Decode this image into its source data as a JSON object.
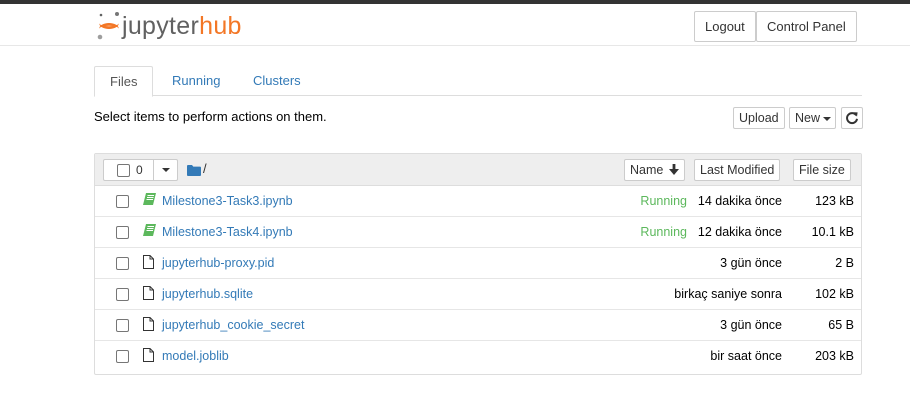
{
  "header": {
    "logo_jupyter": "jupyter",
    "logo_hub": "hub",
    "logout_label": "Logout",
    "control_panel_label": "Control Panel"
  },
  "tabs": [
    {
      "label": "Files",
      "active": true
    },
    {
      "label": "Running",
      "active": false
    },
    {
      "label": "Clusters",
      "active": false
    }
  ],
  "toolbar": {
    "instructions": "Select items to perform actions on them.",
    "upload_label": "Upload",
    "new_label": "New"
  },
  "list_header": {
    "selected_count": "0",
    "breadcrumb": "/",
    "sort_name_label": "Name",
    "sort_modified_label": "Last Modified",
    "sort_size_label": "File size"
  },
  "files": [
    {
      "name": "Milestone3-Task3.ipynb",
      "type": "notebook",
      "status": "Running",
      "modified": "14 dakika önce",
      "size": "123 kB"
    },
    {
      "name": "Milestone3-Task4.ipynb",
      "type": "notebook",
      "status": "Running",
      "modified": "12 dakika önce",
      "size": "10.1 kB"
    },
    {
      "name": "jupyterhub-proxy.pid",
      "type": "file",
      "status": "",
      "modified": "3 gün önce",
      "size": "2 B"
    },
    {
      "name": "jupyterhub.sqlite",
      "type": "file",
      "status": "",
      "modified": "birkaç saniye sonra",
      "size": "102 kB"
    },
    {
      "name": "jupyterhub_cookie_secret",
      "type": "file",
      "status": "",
      "modified": "3 gün önce",
      "size": "65 B"
    },
    {
      "name": "model.joblib",
      "type": "file",
      "status": "",
      "modified": "bir saat önce",
      "size": "203 kB"
    }
  ],
  "icons": {
    "logo": "jupyter-logo-icon",
    "notebook": "notebook-icon",
    "file": "file-icon",
    "folder": "folder-icon",
    "refresh": "refresh-icon",
    "sort": "arrow-down-icon"
  },
  "colors": {
    "link": "#337ab7",
    "running": "#5cb85c",
    "brand_orange": "#f37726",
    "topbar": "#333333"
  }
}
